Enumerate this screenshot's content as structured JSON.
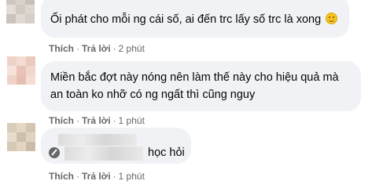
{
  "comments": [
    {
      "text": "Ối phát cho mỗi ng cái số, ai đến trc lấy số trc là xong",
      "emoji": "smile-emoji",
      "like": "Thích",
      "reply": "Trả lời",
      "time": "2 phút"
    },
    {
      "line1": "Miền bắc đợt này nóng nên làm thế này cho hiệu quả mà",
      "line2": "an toàn ko nhỡ có ng ngất thì cũng nguy",
      "like": "Thích",
      "reply": "Trả lời",
      "time": "1 phút"
    },
    {
      "text": "học hỏi",
      "icon": "author-badge-icon",
      "like": "Thích",
      "reply": "Trả lời",
      "time": "1 phút"
    }
  ],
  "separator": "·"
}
